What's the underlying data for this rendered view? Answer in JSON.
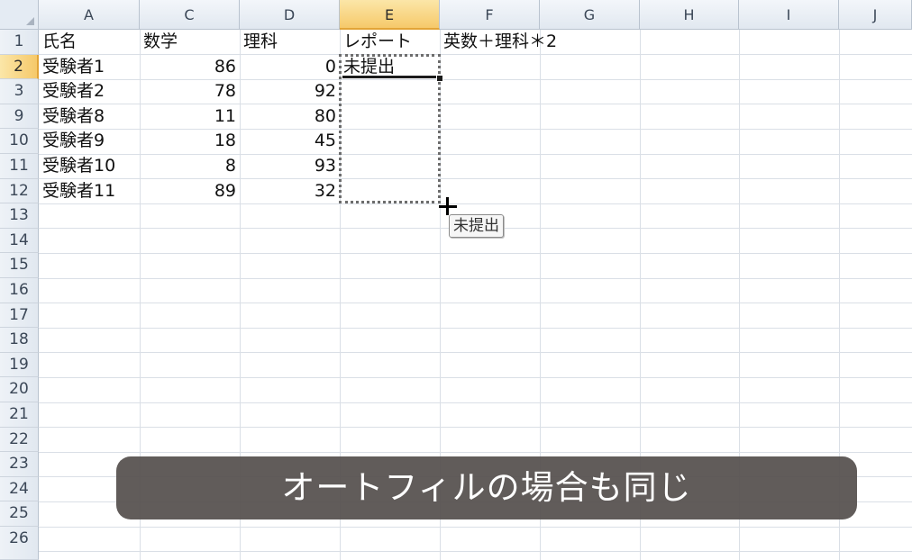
{
  "columns": [
    "A",
    "C",
    "D",
    "E",
    "F",
    "G",
    "H",
    "I",
    "J"
  ],
  "rows": [
    "1",
    "2",
    "3",
    "9",
    "10",
    "11",
    "12",
    "13",
    "14",
    "15",
    "16",
    "17",
    "18",
    "19",
    "20",
    "21",
    "22",
    "23",
    "24",
    "25",
    "26"
  ],
  "selected_column": "E",
  "selected_row": "2",
  "header_cells": {
    "a": "氏名",
    "c": "数学",
    "d": "理科",
    "e": "レポート",
    "f": "英数＋理科＊2"
  },
  "data_rows": [
    {
      "name": "受験者1",
      "math": "86",
      "science": "0",
      "report": "未提出"
    },
    {
      "name": "受験者2",
      "math": "78",
      "science": "92",
      "report": ""
    },
    {
      "name": "受験者8",
      "math": "11",
      "science": "80",
      "report": ""
    },
    {
      "name": "受験者9",
      "math": "18",
      "science": "45",
      "report": ""
    },
    {
      "name": "受験者10",
      "math": "8",
      "science": "93",
      "report": ""
    },
    {
      "name": "受験者11",
      "math": "89",
      "science": "32",
      "report": ""
    }
  ],
  "autofill_tooltip": "未提出",
  "caption": "オートフィルの場合も同じ",
  "colors": {
    "selected_header": "#f6c96a",
    "grid": "#dadfe6",
    "caption_bg": "#55504d"
  }
}
